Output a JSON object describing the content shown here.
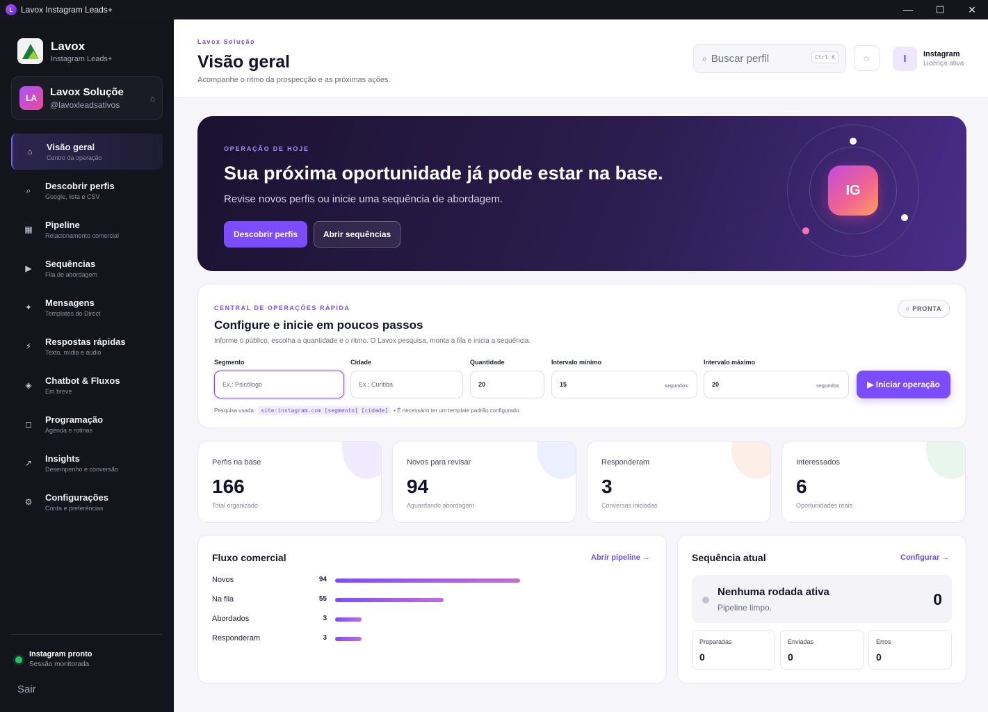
{
  "window": {
    "title": "Lavox Instagram Leads+",
    "controls": [
      "—",
      "☐",
      "✕"
    ]
  },
  "brand": {
    "name": "Lavox",
    "subtitle": "Instagram Leads+"
  },
  "account": {
    "initials": "LA",
    "name": "Lavox Soluçõe",
    "handle": "@lavoxleadsativos"
  },
  "nav": {
    "items": [
      {
        "label": "Visão geral",
        "sub": "Centro da operação",
        "icon": "home-icon",
        "glyph": "⌂",
        "active": true
      },
      {
        "label": "Descobrir perfis",
        "sub": "Google, lista e CSV",
        "icon": "search-icon",
        "glyph": "⌕"
      },
      {
        "label": "Pipeline",
        "sub": "Relacionamento comercial",
        "icon": "grid-icon",
        "glyph": "▦"
      },
      {
        "label": "Sequências",
        "sub": "Fila de abordagem",
        "icon": "play-icon",
        "glyph": "▶"
      },
      {
        "label": "Mensagens",
        "sub": "Templates do Direct",
        "icon": "sparkle-icon",
        "glyph": "✦"
      },
      {
        "label": "Respostas rápidas",
        "sub": "Texto, mídia e áudio",
        "icon": "lightning-icon",
        "glyph": "⚡"
      },
      {
        "label": "Chatbot & Fluxos",
        "sub": "Em breve",
        "icon": "diamond-icon",
        "glyph": "◈"
      },
      {
        "label": "Programação",
        "sub": "Agenda e rotinas",
        "icon": "calendar-icon",
        "glyph": "◻"
      },
      {
        "label": "Insights",
        "sub": "Desempenho e conversão",
        "icon": "trend-icon",
        "glyph": "↗"
      },
      {
        "label": "Configurações",
        "sub": "Conta e preferências",
        "icon": "gear-icon",
        "glyph": "⚙"
      }
    ]
  },
  "status": {
    "title": "Instagram pronto",
    "sub": "Sessão monitorada",
    "color": "#22c55e"
  },
  "logout_label": "Sair",
  "header": {
    "eyebrow": "Lavox Solução",
    "title": "Visão geral",
    "subtitle": "Acompanhe o ritmo da prospecção e as próximas ações.",
    "search_placeholder": "Buscar perfil",
    "search_shortcut": "Ctrl K",
    "profile_initial": "I",
    "profile_name": "Instagram",
    "profile_sub": "Licença ativa"
  },
  "hero": {
    "eyebrow": "OPERAÇÃO DE HOJE",
    "title": "Sua próxima oportunidade já pode estar na base.",
    "subtitle": "Revise novos perfis ou inicie uma sequência de abordagem.",
    "primary_button": "Descobrir perfis",
    "secondary_button": "Abrir sequências",
    "badge": "IG"
  },
  "ops": {
    "eyebrow": "CENTRAL DE OPERAÇÕES RÁPIDA",
    "title": "Configure e inicie em poucos passos",
    "subtitle": "Informe o público, escolha a quantidade e o ritmo. O Lavox pesquisa, monta a fila e inicia a sequência.",
    "status_badge": "○ PRONTA",
    "fields": {
      "segmento": {
        "label": "Segmento",
        "placeholder": "Ex.: Psicólogo"
      },
      "cidade": {
        "label": "Cidade",
        "placeholder": "Ex.: Curitiba"
      },
      "quantidade": {
        "label": "Quantidade",
        "value": "20"
      },
      "intervalo_min": {
        "label": "Intervalo mínimo",
        "value": "15",
        "suffix": "segundos"
      },
      "intervalo_max": {
        "label": "Intervalo máximo",
        "value": "20",
        "suffix": "segundos"
      }
    },
    "start_button": "▶ Iniciar operação",
    "hint_prefix": "Pesquisa usada:",
    "hint_code": "site:instagram.com [segmento] [cidade]",
    "hint_suffix": "• É necessário ter um template padrão configurado."
  },
  "stats": [
    {
      "label": "Perfis na base",
      "value": "166",
      "sub": "Total organizado",
      "accent": "#efeafd"
    },
    {
      "label": "Novos para revisar",
      "value": "94",
      "sub": "Aguardando abordagem",
      "accent": "#eaf0fd"
    },
    {
      "label": "Responderam",
      "value": "3",
      "sub": "Conversas iniciadas",
      "accent": "#fdefe8"
    },
    {
      "label": "Interessados",
      "value": "6",
      "sub": "Oportunidades reais",
      "accent": "#e9f6ee"
    }
  ],
  "flow": {
    "title": "Fluxo comercial",
    "link": "Abrir pipeline →",
    "rows": [
      {
        "label": "Novos",
        "value": 94
      },
      {
        "label": "Na fila",
        "value": 55
      },
      {
        "label": "Abordados",
        "value": 3
      },
      {
        "label": "Responderam",
        "value": 3
      }
    ]
  },
  "sequence": {
    "title": "Sequência atual",
    "link": "Configurar →",
    "state_title": "Nenhuma rodada ativa",
    "state_sub": "Pipeline limpo.",
    "count": "0",
    "minis": [
      {
        "label": "Preparadas",
        "value": "0"
      },
      {
        "label": "Enviadas",
        "value": "0"
      },
      {
        "label": "Erros",
        "value": "0"
      }
    ]
  }
}
